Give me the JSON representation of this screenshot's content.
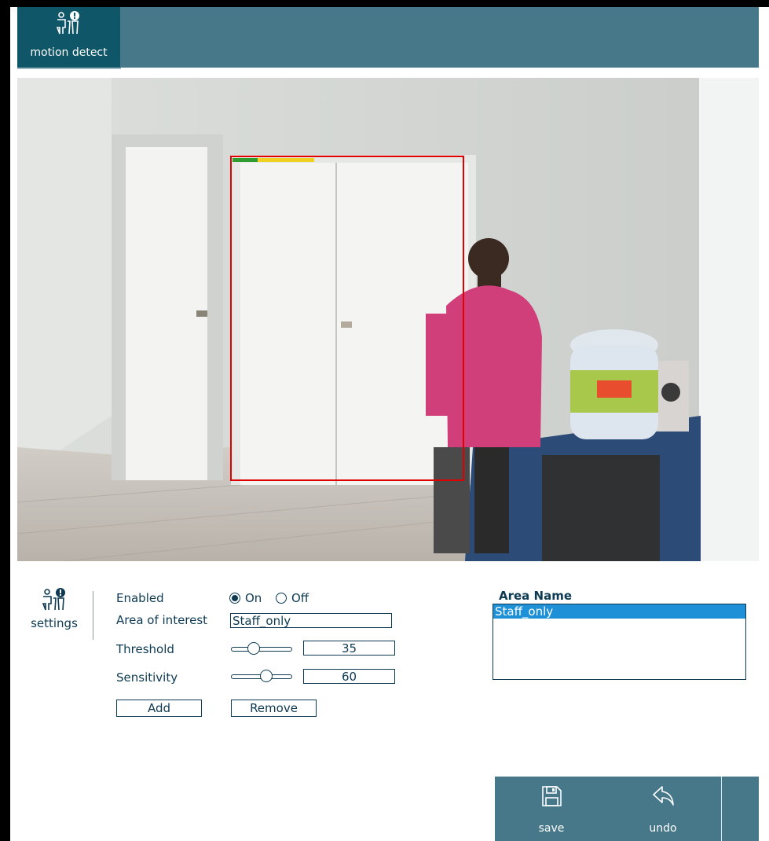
{
  "tabs": [
    {
      "label": "motion detect",
      "icon": "motion-detect-icon",
      "active": true
    }
  ],
  "settings_panel": {
    "label": "settings",
    "icon": "motion-settings-icon"
  },
  "form": {
    "enabled_label": "Enabled",
    "on_label": "On",
    "off_label": "Off",
    "enabled_value": "On",
    "area_label": "Area of interest",
    "area_value": "Staff_only",
    "threshold_label": "Threshold",
    "threshold_value": "35",
    "sensitivity_label": "Sensitivity",
    "sensitivity_value": "60",
    "add_label": "Add",
    "remove_label": "Remove"
  },
  "area_list": {
    "title": "Area Name",
    "items": [
      "Staff_only"
    ],
    "selected": "Staff_only"
  },
  "actions": {
    "save_label": "save",
    "undo_label": "undo"
  },
  "colors": {
    "header": "#467889",
    "active_tab": "#0f5668",
    "text": "#0d3a52",
    "selection": "#1e90d8",
    "roi_box": "#e00000",
    "activity_low": "#2e9c2e",
    "activity_high": "#f0d020"
  }
}
